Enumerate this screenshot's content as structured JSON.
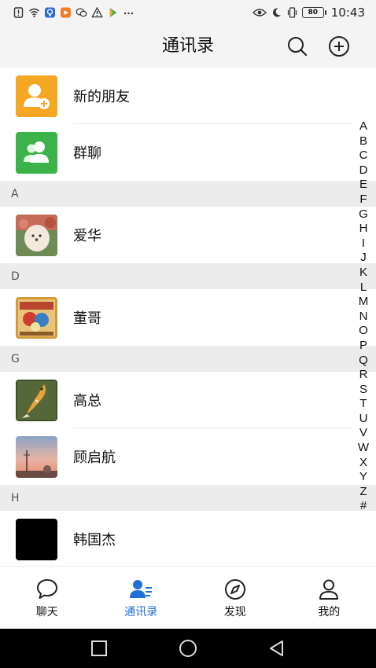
{
  "status_bar": {
    "time": "10:43",
    "battery": "80",
    "left_icons": [
      "alert-icon",
      "wifi-icon",
      "app-icon",
      "video-app-icon",
      "wechat-icon",
      "warning-icon",
      "game-app-icon",
      "more-dots-icon"
    ],
    "right_icons": [
      "eye-icon",
      "moon-icon",
      "vibrate-icon",
      "battery-icon"
    ]
  },
  "header": {
    "title": "通讯录",
    "search_icon": "search-icon",
    "add_icon": "add-circle-icon"
  },
  "contacts": {
    "new_friends": "新的朋友",
    "group_chat": "群聊",
    "sections": [
      {
        "letter": "A",
        "items": [
          "爱华"
        ]
      },
      {
        "letter": "D",
        "items": [
          "董哥"
        ]
      },
      {
        "letter": "G",
        "items": [
          "高总",
          "顾启航"
        ]
      },
      {
        "letter": "H",
        "items": [
          "韩国杰"
        ]
      }
    ]
  },
  "alphabet_index": [
    "A",
    "B",
    "C",
    "D",
    "E",
    "F",
    "G",
    "H",
    "I",
    "J",
    "K",
    "L",
    "M",
    "N",
    "O",
    "P",
    "Q",
    "R",
    "S",
    "T",
    "U",
    "V",
    "W",
    "X",
    "Y",
    "Z",
    "#"
  ],
  "tabs": [
    {
      "label": "聊天",
      "icon": "chat-icon",
      "active": false
    },
    {
      "label": "通讯录",
      "icon": "contacts-icon",
      "active": true
    },
    {
      "label": "发现",
      "icon": "compass-icon",
      "active": false
    },
    {
      "label": "我的",
      "icon": "profile-icon",
      "active": false
    }
  ],
  "colors": {
    "accent": "#1f6fd8",
    "new_friends_icon": "#f5a623",
    "group_chat_icon": "#3cb34a",
    "section_bg": "#ececec"
  }
}
